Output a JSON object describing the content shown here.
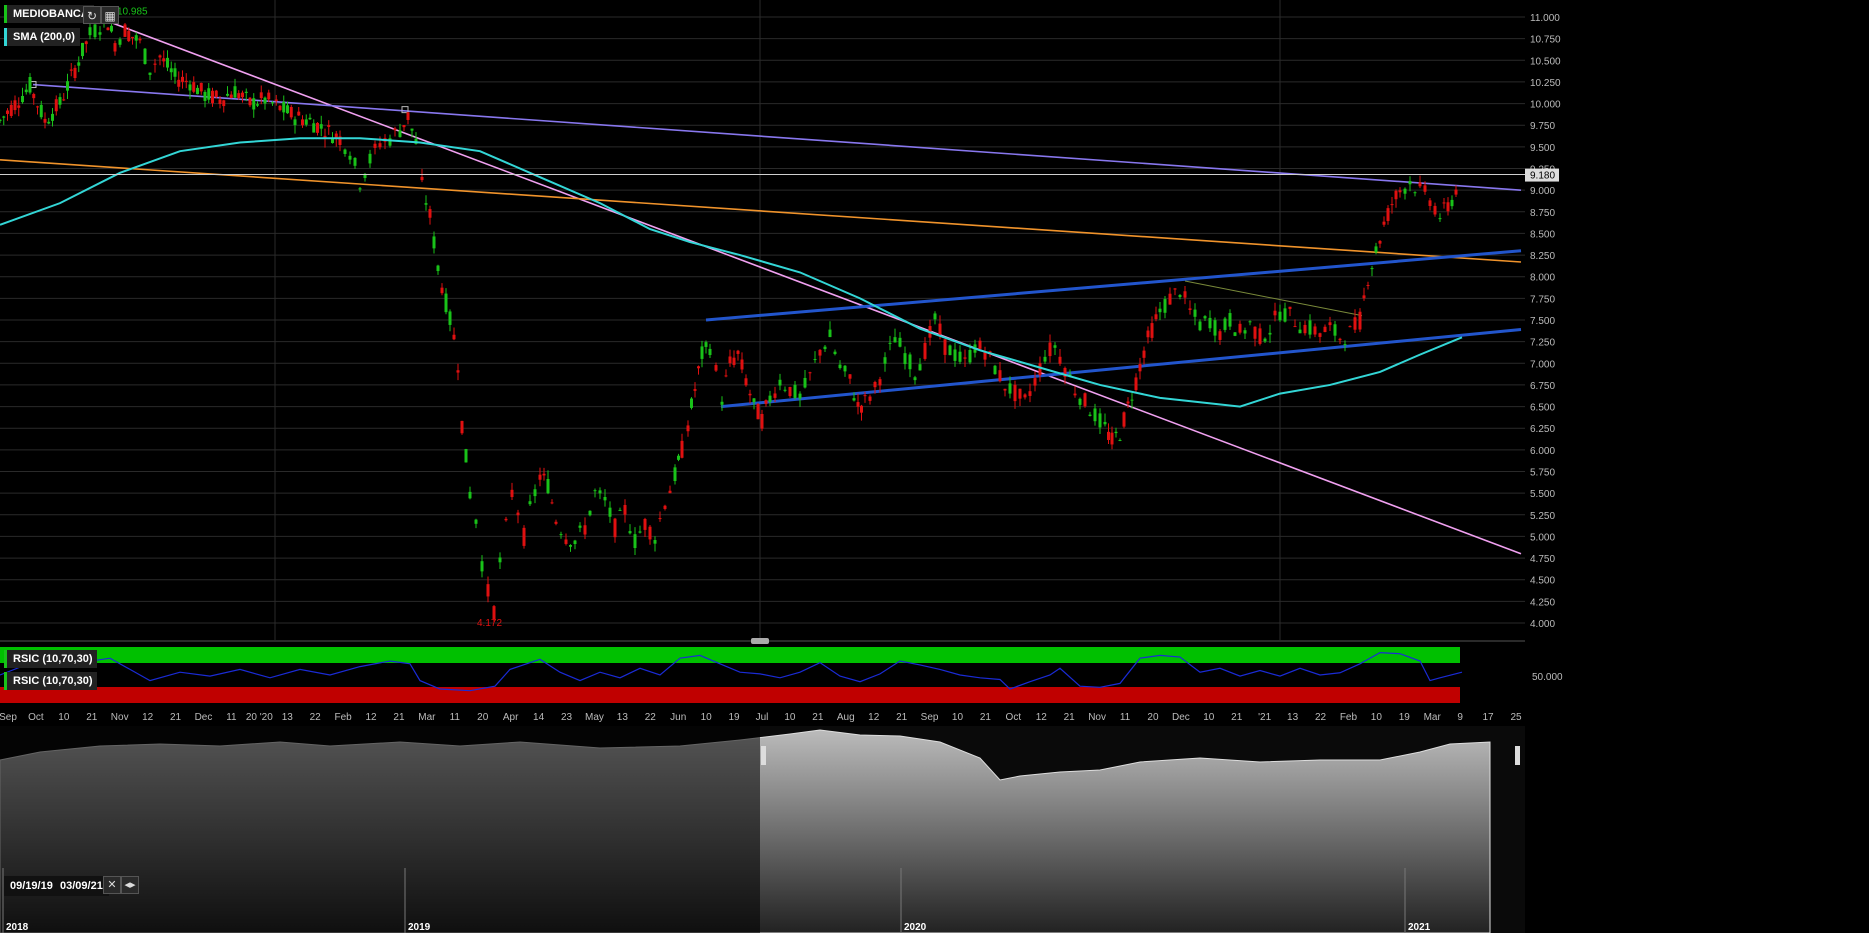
{
  "instrument": {
    "name": "MEDIOBANCA"
  },
  "indicators": {
    "sma_label": "SMA (200,0)",
    "rsi_label_1": "RSIC (10,70,30)",
    "rsi_label_2": "RSIC (10,70,30)"
  },
  "toolbar": {
    "refresh_icon": "refresh-icon",
    "settings_icon": "chart-settings-icon"
  },
  "colors": {
    "up": "#19c219",
    "down": "#e01010",
    "sma": "#33d6d6",
    "trend_pink": "#f0a0f0",
    "trend_purple": "#8877ee",
    "trend_orange": "#f0932b",
    "channel": "#2255cc",
    "rsi_line": "#1a2bd6",
    "rsi_over": "#00c000",
    "rsi_under": "#c00000"
  },
  "range": {
    "from": "09/19/19",
    "to": "03/09/21"
  },
  "chart_data": {
    "type": "candlestick",
    "title": "MEDIOBANCA",
    "ylim": [
      4.0,
      11.0
    ],
    "y_ticks": [
      "11.000",
      "10.750",
      "10.500",
      "10.250",
      "10.000",
      "9.750",
      "9.500",
      "9.250",
      "9.000",
      "8.750",
      "8.500",
      "8.250",
      "8.000",
      "7.750",
      "7.500",
      "7.250",
      "7.000",
      "6.750",
      "6.500",
      "6.250",
      "6.000",
      "5.750",
      "5.500",
      "5.250",
      "5.000",
      "4.750",
      "4.500",
      "4.250",
      "4.000"
    ],
    "x_ticks": [
      "Sep",
      "Oct",
      "10",
      "21",
      "Nov",
      "12",
      "21",
      "Dec",
      "11",
      "20 '20",
      "13",
      "22",
      "Feb",
      "12",
      "21",
      "Mar",
      "11",
      "20",
      "Apr",
      "14",
      "23",
      "May",
      "13",
      "22",
      "Jun",
      "10",
      "19",
      "Jul",
      "10",
      "21",
      "Aug",
      "12",
      "21",
      "Sep",
      "10",
      "21",
      "Oct",
      "12",
      "21",
      "Nov",
      "11",
      "20",
      "Dec",
      "10",
      "21",
      "'21",
      "13",
      "22",
      "Feb",
      "10",
      "19",
      "Mar",
      "9",
      "17",
      "25"
    ],
    "last_price": "9.180",
    "last_value": 9.18,
    "high_label": "10.985",
    "high_value": 10.985,
    "low_label": "4.172",
    "low_value": 4.172,
    "price_path": [
      [
        0,
        9.8
      ],
      [
        15,
        10.0
      ],
      [
        30,
        10.2
      ],
      [
        45,
        9.8
      ],
      [
        60,
        10.0
      ],
      [
        75,
        10.4
      ],
      [
        90,
        10.8
      ],
      [
        100,
        10.9
      ],
      [
        108,
        10.95
      ],
      [
        115,
        10.7
      ],
      [
        125,
        10.85
      ],
      [
        140,
        10.7
      ],
      [
        150,
        10.4
      ],
      [
        160,
        10.55
      ],
      [
        175,
        10.3
      ],
      [
        190,
        10.25
      ],
      [
        205,
        10.1
      ],
      [
        220,
        10.05
      ],
      [
        235,
        10.15
      ],
      [
        250,
        10.0
      ],
      [
        265,
        10.05
      ],
      [
        280,
        9.95
      ],
      [
        295,
        9.85
      ],
      [
        310,
        9.8
      ],
      [
        325,
        9.7
      ],
      [
        340,
        9.6
      ],
      [
        350,
        9.45
      ],
      [
        360,
        9.1
      ],
      [
        370,
        9.35
      ],
      [
        380,
        9.55
      ],
      [
        390,
        9.6
      ],
      [
        400,
        9.7
      ],
      [
        408,
        9.85
      ],
      [
        416,
        9.55
      ],
      [
        422,
        9.05
      ],
      [
        430,
        8.7
      ],
      [
        438,
        8.1
      ],
      [
        446,
        7.7
      ],
      [
        454,
        7.3
      ],
      [
        458,
        7.0
      ],
      [
        462,
        6.3
      ],
      [
        470,
        5.5
      ],
      [
        476,
        5.2
      ],
      [
        482,
        4.7
      ],
      [
        488,
        4.35
      ],
      [
        494,
        4.15
      ],
      [
        500,
        4.7
      ],
      [
        506,
        5.1
      ],
      [
        512,
        5.5
      ],
      [
        518,
        5.3
      ],
      [
        524,
        5.0
      ],
      [
        530,
        5.3
      ],
      [
        540,
        5.7
      ],
      [
        548,
        5.6
      ],
      [
        556,
        5.2
      ],
      [
        566,
        5.0
      ],
      [
        575,
        4.95
      ],
      [
        585,
        5.1
      ],
      [
        595,
        5.5
      ],
      [
        605,
        5.4
      ],
      [
        615,
        5.1
      ],
      [
        625,
        5.3
      ],
      [
        635,
        4.95
      ],
      [
        645,
        5.15
      ],
      [
        655,
        5.0
      ],
      [
        665,
        5.4
      ],
      [
        675,
        5.7
      ],
      [
        682,
        6.0
      ],
      [
        688,
        6.3
      ],
      [
        695,
        6.7
      ],
      [
        702,
        7.1
      ],
      [
        710,
        7.2
      ],
      [
        716,
        6.9
      ],
      [
        722,
        6.6
      ],
      [
        730,
        7.0
      ],
      [
        738,
        7.1
      ],
      [
        746,
        6.8
      ],
      [
        754,
        6.5
      ],
      [
        762,
        6.35
      ],
      [
        770,
        6.6
      ],
      [
        780,
        6.8
      ],
      [
        790,
        6.7
      ],
      [
        800,
        6.6
      ],
      [
        810,
        6.85
      ],
      [
        820,
        7.15
      ],
      [
        830,
        7.3
      ],
      [
        840,
        6.95
      ],
      [
        850,
        6.8
      ],
      [
        858,
        6.5
      ],
      [
        865,
        6.55
      ],
      [
        875,
        6.7
      ],
      [
        885,
        7.0
      ],
      [
        895,
        7.3
      ],
      [
        905,
        7.1
      ],
      [
        915,
        6.9
      ],
      [
        925,
        7.15
      ],
      [
        935,
        7.5
      ],
      [
        945,
        7.2
      ],
      [
        955,
        7.1
      ],
      [
        965,
        7.0
      ],
      [
        975,
        7.2
      ],
      [
        985,
        7.15
      ],
      [
        995,
        6.95
      ],
      [
        1005,
        6.75
      ],
      [
        1015,
        6.65
      ],
      [
        1025,
        6.55
      ],
      [
        1035,
        6.8
      ],
      [
        1045,
        7.1
      ],
      [
        1055,
        7.2
      ],
      [
        1065,
        6.95
      ],
      [
        1075,
        6.7
      ],
      [
        1085,
        6.55
      ],
      [
        1095,
        6.4
      ],
      [
        1105,
        6.25
      ],
      [
        1112,
        6.1
      ],
      [
        1120,
        6.2
      ],
      [
        1128,
        6.5
      ],
      [
        1136,
        6.8
      ],
      [
        1144,
        7.15
      ],
      [
        1152,
        7.4
      ],
      [
        1160,
        7.6
      ],
      [
        1170,
        7.75
      ],
      [
        1180,
        7.85
      ],
      [
        1190,
        7.6
      ],
      [
        1200,
        7.45
      ],
      [
        1210,
        7.5
      ],
      [
        1220,
        7.35
      ],
      [
        1230,
        7.5
      ],
      [
        1240,
        7.35
      ],
      [
        1250,
        7.45
      ],
      [
        1260,
        7.3
      ],
      [
        1270,
        7.4
      ],
      [
        1280,
        7.6
      ],
      [
        1290,
        7.55
      ],
      [
        1300,
        7.45
      ],
      [
        1310,
        7.4
      ],
      [
        1320,
        7.35
      ],
      [
        1330,
        7.4
      ],
      [
        1340,
        7.3
      ],
      [
        1350,
        7.35
      ],
      [
        1360,
        7.5
      ],
      [
        1368,
        8.0
      ],
      [
        1376,
        8.3
      ],
      [
        1384,
        8.6
      ],
      [
        1392,
        8.85
      ],
      [
        1400,
        9.0
      ],
      [
        1410,
        9.1
      ],
      [
        1420,
        9.0
      ],
      [
        1430,
        8.9
      ],
      [
        1440,
        8.7
      ],
      [
        1448,
        8.8
      ],
      [
        1456,
        9.0
      ],
      [
        1462,
        9.18
      ]
    ],
    "sma_200": [
      [
        0,
        8.6
      ],
      [
        60,
        8.85
      ],
      [
        120,
        9.2
      ],
      [
        180,
        9.45
      ],
      [
        240,
        9.55
      ],
      [
        300,
        9.6
      ],
      [
        360,
        9.6
      ],
      [
        420,
        9.55
      ],
      [
        480,
        9.45
      ],
      [
        540,
        9.15
      ],
      [
        600,
        8.85
      ],
      [
        650,
        8.55
      ],
      [
        690,
        8.4
      ],
      [
        740,
        8.25
      ],
      [
        800,
        8.05
      ],
      [
        860,
        7.75
      ],
      [
        920,
        7.4
      ],
      [
        980,
        7.15
      ],
      [
        1040,
        6.95
      ],
      [
        1100,
        6.75
      ],
      [
        1160,
        6.6
      ],
      [
        1200,
        6.55
      ],
      [
        1240,
        6.5
      ],
      [
        1280,
        6.65
      ],
      [
        1330,
        6.75
      ],
      [
        1380,
        6.9
      ],
      [
        1420,
        7.1
      ],
      [
        1462,
        7.3
      ]
    ],
    "trendlines": [
      {
        "color_key": "trend_pink",
        "points": [
          [
            108,
            10.95
          ],
          [
            1521,
            4.8
          ]
        ]
      },
      {
        "color_key": "trend_purple",
        "points": [
          [
            33,
            10.22
          ],
          [
            1521,
            9.0
          ]
        ]
      },
      {
        "color_key": "trend_orange",
        "points": [
          [
            0,
            9.35
          ],
          [
            1521,
            8.17
          ]
        ]
      },
      {
        "color_key": "channel",
        "points": [
          [
            706,
            7.5
          ],
          [
            1521,
            8.3
          ]
        ]
      },
      {
        "color_key": "channel",
        "points": [
          [
            721,
            6.5
          ],
          [
            1521,
            7.39
          ]
        ]
      },
      {
        "color_key": "trend_thin",
        "points": [
          [
            1185,
            7.95
          ],
          [
            1362,
            7.55
          ]
        ]
      }
    ],
    "rsi_series": [
      [
        0,
        50
      ],
      [
        40,
        78
      ],
      [
        80,
        72
      ],
      [
        110,
        80
      ],
      [
        130,
        60
      ],
      [
        150,
        40
      ],
      [
        180,
        55
      ],
      [
        210,
        48
      ],
      [
        240,
        60
      ],
      [
        270,
        45
      ],
      [
        300,
        60
      ],
      [
        330,
        50
      ],
      [
        360,
        65
      ],
      [
        390,
        75
      ],
      [
        410,
        70
      ],
      [
        420,
        40
      ],
      [
        440,
        25
      ],
      [
        470,
        22
      ],
      [
        495,
        30
      ],
      [
        510,
        60
      ],
      [
        540,
        78
      ],
      [
        560,
        55
      ],
      [
        580,
        40
      ],
      [
        600,
        55
      ],
      [
        620,
        45
      ],
      [
        640,
        62
      ],
      [
        660,
        50
      ],
      [
        680,
        80
      ],
      [
        700,
        85
      ],
      [
        720,
        70
      ],
      [
        740,
        55
      ],
      [
        760,
        52
      ],
      [
        780,
        45
      ],
      [
        800,
        55
      ],
      [
        820,
        72
      ],
      [
        840,
        48
      ],
      [
        860,
        38
      ],
      [
        880,
        52
      ],
      [
        900,
        75
      ],
      [
        920,
        68
      ],
      [
        940,
        60
      ],
      [
        960,
        50
      ],
      [
        980,
        45
      ],
      [
        1000,
        42
      ],
      [
        1010,
        25
      ],
      [
        1030,
        38
      ],
      [
        1050,
        50
      ],
      [
        1060,
        62
      ],
      [
        1080,
        30
      ],
      [
        1100,
        28
      ],
      [
        1120,
        35
      ],
      [
        1140,
        80
      ],
      [
        1160,
        85
      ],
      [
        1180,
        82
      ],
      [
        1200,
        55
      ],
      [
        1220,
        62
      ],
      [
        1240,
        48
      ],
      [
        1260,
        58
      ],
      [
        1280,
        48
      ],
      [
        1300,
        62
      ],
      [
        1320,
        50
      ],
      [
        1340,
        54
      ],
      [
        1360,
        70
      ],
      [
        1380,
        90
      ],
      [
        1400,
        88
      ],
      [
        1420,
        75
      ],
      [
        1430,
        40
      ],
      [
        1440,
        45
      ],
      [
        1462,
        55
      ]
    ],
    "rsi_levels": [
      70,
      30
    ],
    "rsi_label": "50.000",
    "overview_years": [
      "2018",
      "2019",
      "2020",
      "2021"
    ]
  }
}
